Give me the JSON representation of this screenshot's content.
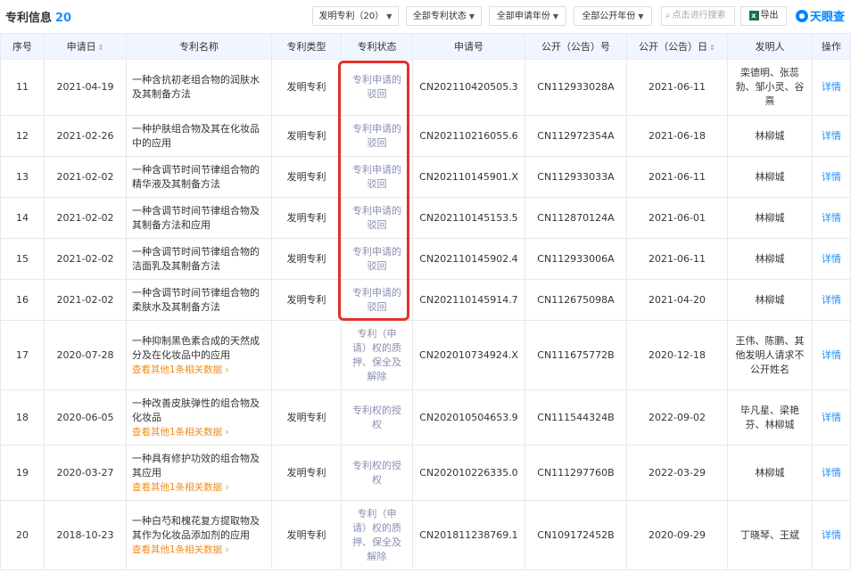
{
  "header": {
    "title": "专利信息",
    "count": "20",
    "filters": [
      {
        "label": "发明专利（20）"
      },
      {
        "label": "全部专利状态"
      },
      {
        "label": "全部申请年份"
      },
      {
        "label": "全部公开年份"
      }
    ],
    "search_placeholder": "点击进行搜索",
    "export_label": "导出",
    "logo_text": "天眼查"
  },
  "table": {
    "columns": [
      "序号",
      "申请日",
      "专利名称",
      "专利类型",
      "专利状态",
      "申请号",
      "公开（公告）号",
      "公开（公告）日",
      "发明人",
      "操作"
    ],
    "rows": [
      {
        "no": "11",
        "date": "2021-04-19",
        "name": "一种含抗初老组合物的润肤水及其制备方法",
        "more": "",
        "type": "发明专利",
        "status": "专利申请的驳回",
        "app_no": "CN202110420505.3",
        "pub_no": "CN112933028A",
        "pub_date": "2021-06-11",
        "inventor": "栾德明、张蕊勃、邹小灵、谷熹",
        "action": "详情"
      },
      {
        "no": "12",
        "date": "2021-02-26",
        "name": "一种护肤组合物及其在化妆品中的应用",
        "more": "",
        "type": "发明专利",
        "status": "专利申请的驳回",
        "app_no": "CN202110216055.6",
        "pub_no": "CN112972354A",
        "pub_date": "2021-06-18",
        "inventor": "林柳城",
        "action": "详情"
      },
      {
        "no": "13",
        "date": "2021-02-02",
        "name": "一种含调节时间节律组合物的精华液及其制备方法",
        "more": "",
        "type": "发明专利",
        "status": "专利申请的驳回",
        "app_no": "CN202110145901.X",
        "pub_no": "CN112933033A",
        "pub_date": "2021-06-11",
        "inventor": "林柳城",
        "action": "详情"
      },
      {
        "no": "14",
        "date": "2021-02-02",
        "name": "一种含调节时间节律组合物及其制备方法和应用",
        "more": "",
        "type": "发明专利",
        "status": "专利申请的驳回",
        "app_no": "CN202110145153.5",
        "pub_no": "CN112870124A",
        "pub_date": "2021-06-01",
        "inventor": "林柳城",
        "action": "详情"
      },
      {
        "no": "15",
        "date": "2021-02-02",
        "name": "一种含调节时间节律组合物的洁面乳及其制备方法",
        "more": "",
        "type": "发明专利",
        "status": "专利申请的驳回",
        "app_no": "CN202110145902.4",
        "pub_no": "CN112933006A",
        "pub_date": "2021-06-11",
        "inventor": "林柳城",
        "action": "详情"
      },
      {
        "no": "16",
        "date": "2021-02-02",
        "name": "一种含调节时间节律组合物的柔肤水及其制备方法",
        "more": "",
        "type": "发明专利",
        "status": "专利申请的驳回",
        "app_no": "CN202110145914.7",
        "pub_no": "CN112675098A",
        "pub_date": "2021-04-20",
        "inventor": "林柳城",
        "action": "详情"
      },
      {
        "no": "17",
        "date": "2020-07-28",
        "name": "一种抑制黑色素合成的天然成分及在化妆品中的应用",
        "more": "查看其他1条相关数据",
        "type": "",
        "status": "专利（申请）权的质押、保全及解除",
        "app_no": "CN202010734924.X",
        "pub_no": "CN111675772B",
        "pub_date": "2020-12-18",
        "inventor": "王伟、陈鹏、其他发明人请求不公开姓名",
        "action": "详情"
      },
      {
        "no": "18",
        "date": "2020-06-05",
        "name": "一种改善皮肤弹性的组合物及化妆品",
        "more": "查看其他1条相关数据",
        "type": "发明专利",
        "status": "专利权的授权",
        "app_no": "CN202010504653.9",
        "pub_no": "CN111544324B",
        "pub_date": "2022-09-02",
        "inventor": "毕凡星、梁艳芬、林柳城",
        "action": "详情"
      },
      {
        "no": "19",
        "date": "2020-03-27",
        "name": "一种具有修护功效的组合物及其应用",
        "more": "查看其他1条相关数据",
        "type": "发明专利",
        "status": "专利权的授权",
        "app_no": "CN202010226335.0",
        "pub_no": "CN111297760B",
        "pub_date": "2022-03-29",
        "inventor": "林柳城",
        "action": "详情"
      },
      {
        "no": "20",
        "date": "2018-10-23",
        "name": "一种白芍和槐花复方提取物及其作为化妆品添加剂的应用",
        "more": "查看其他1条相关数据",
        "type": "发明专利",
        "status": "专利（申请）权的质押、保全及解除",
        "app_no": "CN201811238769.1",
        "pub_no": "CN109172452B",
        "pub_date": "2020-09-29",
        "inventor": "丁晓琴、王斌",
        "action": "详情"
      }
    ]
  }
}
